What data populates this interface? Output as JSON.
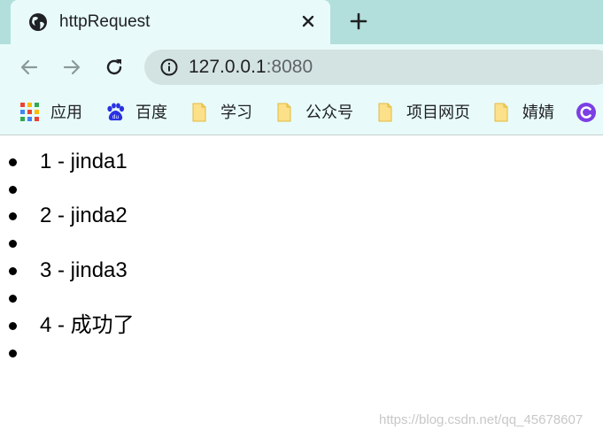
{
  "tab": {
    "title": "httpRequest",
    "favicon": "globe-icon"
  },
  "toolbar": {
    "url_host": "127.0.0.1",
    "url_port": ":8080"
  },
  "bookmarks": [
    {
      "label": "应用",
      "icon": "apps-grid-icon"
    },
    {
      "label": "百度",
      "icon": "baidu-paw-icon"
    },
    {
      "label": "学习",
      "icon": "folder-icon"
    },
    {
      "label": "公众号",
      "icon": "folder-icon"
    },
    {
      "label": "项目网页",
      "icon": "folder-icon"
    },
    {
      "label": "婧婧",
      "icon": "folder-icon"
    },
    {
      "label": "",
      "icon": "purple-circle-icon"
    }
  ],
  "list": [
    {
      "text": "1 - jinda1"
    },
    {
      "text": ""
    },
    {
      "text": "2 - jinda2"
    },
    {
      "text": ""
    },
    {
      "text": "3 - jinda3"
    },
    {
      "text": ""
    },
    {
      "text": "4 - 成功了"
    },
    {
      "text": ""
    }
  ],
  "watermark": "https://blog.csdn.net/qq_45678607",
  "colors": {
    "tab_strip": "#b2dfdb",
    "toolbar": "#e8fbfa",
    "omnibox": "#d3e3e2",
    "folder": "#fce18a"
  }
}
